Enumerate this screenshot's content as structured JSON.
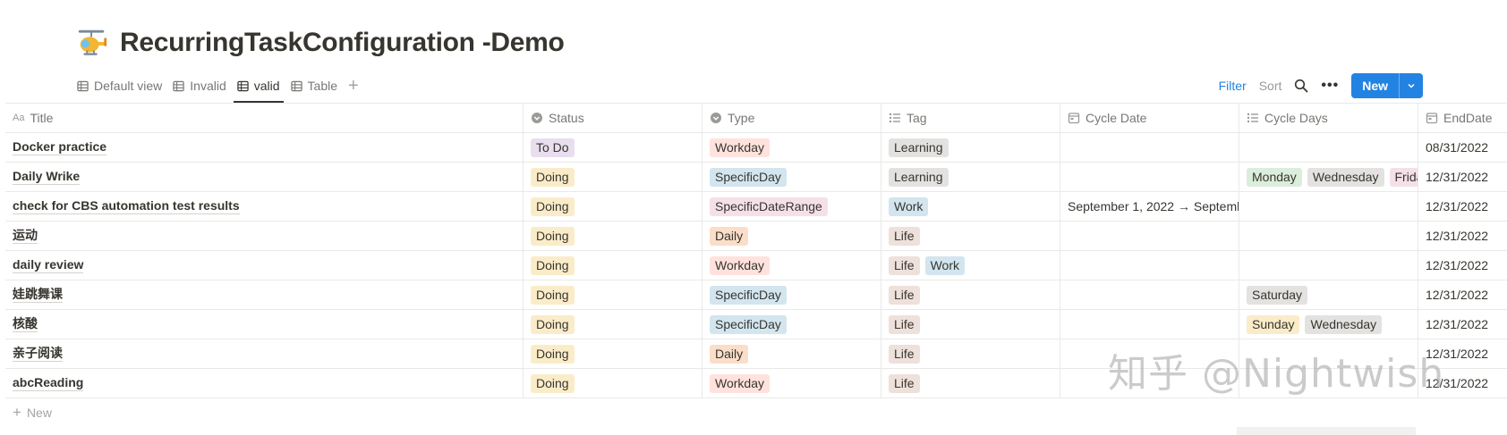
{
  "page": {
    "icon": "helicopter-icon",
    "title": "RecurringTaskConfiguration -Demo"
  },
  "views": [
    {
      "label": "Default view",
      "icon": "table-icon",
      "active": false
    },
    {
      "label": "Invalid",
      "icon": "table-icon",
      "active": false
    },
    {
      "label": "valid",
      "icon": "table-icon",
      "active": true
    },
    {
      "label": "Table",
      "icon": "table-icon",
      "active": false
    }
  ],
  "add_view_icon": "plus-icon",
  "actions": {
    "filter": "Filter",
    "sort": "Sort",
    "search_icon": "search-icon",
    "more_icon": "more-icon",
    "more": "•••",
    "new": "New",
    "new_chevron": "chevron-down-icon"
  },
  "columns": [
    {
      "label": "Title",
      "icon": "text-icon"
    },
    {
      "label": "Status",
      "icon": "status-icon"
    },
    {
      "label": "Type",
      "icon": "select-icon"
    },
    {
      "label": "Tag",
      "icon": "multiselect-icon"
    },
    {
      "label": "Cycle Date",
      "icon": "calendar-icon"
    },
    {
      "label": "Cycle Days",
      "icon": "multiselect-icon"
    },
    {
      "label": "EndDate",
      "icon": "calendar-icon"
    }
  ],
  "colors": {
    "todo": "#e8deee",
    "doing": "#fbecc9",
    "workday": "#ffe2dd",
    "specificday": "#d3e5ef",
    "specificdaterange": "#f5e0e9",
    "daily": "#fadec9",
    "learning": "#e3e2e0",
    "work": "#d3e5ef",
    "life": "#eee0da",
    "monday": "#dbeddb",
    "wednesday": "#e3e2e0",
    "friday": "#f5e0e9",
    "saturday": "#e3e2e0",
    "sunday": "#fbecc9",
    "accent": "#2383e2"
  },
  "rows": [
    {
      "title": "Docker practice",
      "status": "To Do",
      "status_color": "#e8deee",
      "type": "Workday",
      "type_color": "#ffe2dd",
      "tags": [
        {
          "label": "Learning",
          "color": "#e3e2e0"
        }
      ],
      "cycle_date": "",
      "cycle_days": [],
      "end_date": "08/31/2022"
    },
    {
      "title": "Daily Wrike",
      "status": "Doing",
      "status_color": "#fbecc9",
      "type": "SpecificDay",
      "type_color": "#d3e5ef",
      "tags": [
        {
          "label": "Learning",
          "color": "#e3e2e0"
        }
      ],
      "cycle_date": "",
      "cycle_days": [
        {
          "label": "Monday",
          "color": "#dbeddb"
        },
        {
          "label": "Wednesday",
          "color": "#e3e2e0"
        },
        {
          "label": "Frida",
          "color": "#f5e0e9"
        }
      ],
      "end_date": "12/31/2022"
    },
    {
      "title": "check for CBS automation test results",
      "status": "Doing",
      "status_color": "#fbecc9",
      "type": "SpecificDateRange",
      "type_color": "#f5e0e9",
      "tags": [
        {
          "label": "Work",
          "color": "#d3e5ef"
        }
      ],
      "cycle_date": "September 1, 2022 → Septemb",
      "cycle_days": [],
      "end_date": "12/31/2022"
    },
    {
      "title": "运动",
      "status": "Doing",
      "status_color": "#fbecc9",
      "type": "Daily",
      "type_color": "#fadec9",
      "tags": [
        {
          "label": "Life",
          "color": "#eee0da"
        }
      ],
      "cycle_date": "",
      "cycle_days": [],
      "end_date": "12/31/2022"
    },
    {
      "title": "daily review",
      "status": "Doing",
      "status_color": "#fbecc9",
      "type": "Workday",
      "type_color": "#ffe2dd",
      "tags": [
        {
          "label": "Life",
          "color": "#eee0da"
        },
        {
          "label": "Work",
          "color": "#d3e5ef"
        }
      ],
      "cycle_date": "",
      "cycle_days": [],
      "end_date": "12/31/2022"
    },
    {
      "title": "娃跳舞课",
      "status": "Doing",
      "status_color": "#fbecc9",
      "type": "SpecificDay",
      "type_color": "#d3e5ef",
      "tags": [
        {
          "label": "Life",
          "color": "#eee0da"
        }
      ],
      "cycle_date": "",
      "cycle_days": [
        {
          "label": "Saturday",
          "color": "#e3e2e0"
        }
      ],
      "end_date": "12/31/2022"
    },
    {
      "title": "核酸",
      "status": "Doing",
      "status_color": "#fbecc9",
      "type": "SpecificDay",
      "type_color": "#d3e5ef",
      "tags": [
        {
          "label": "Life",
          "color": "#eee0da"
        }
      ],
      "cycle_date": "",
      "cycle_days": [
        {
          "label": "Sunday",
          "color": "#fbecc9"
        },
        {
          "label": "Wednesday",
          "color": "#e3e2e0"
        }
      ],
      "end_date": "12/31/2022"
    },
    {
      "title": "亲子阅读",
      "status": "Doing",
      "status_color": "#fbecc9",
      "type": "Daily",
      "type_color": "#fadec9",
      "tags": [
        {
          "label": "Life",
          "color": "#eee0da"
        }
      ],
      "cycle_date": "",
      "cycle_days": [],
      "end_date": "12/31/2022"
    },
    {
      "title": "abcReading",
      "status": "Doing",
      "status_color": "#fbecc9",
      "type": "Workday",
      "type_color": "#ffe2dd",
      "tags": [
        {
          "label": "Life",
          "color": "#eee0da"
        }
      ],
      "cycle_date": "",
      "cycle_days": [],
      "end_date": "12/31/2022"
    }
  ],
  "new_row": {
    "icon": "plus-icon",
    "label": "New"
  },
  "watermark": "知乎 @Nightwish"
}
